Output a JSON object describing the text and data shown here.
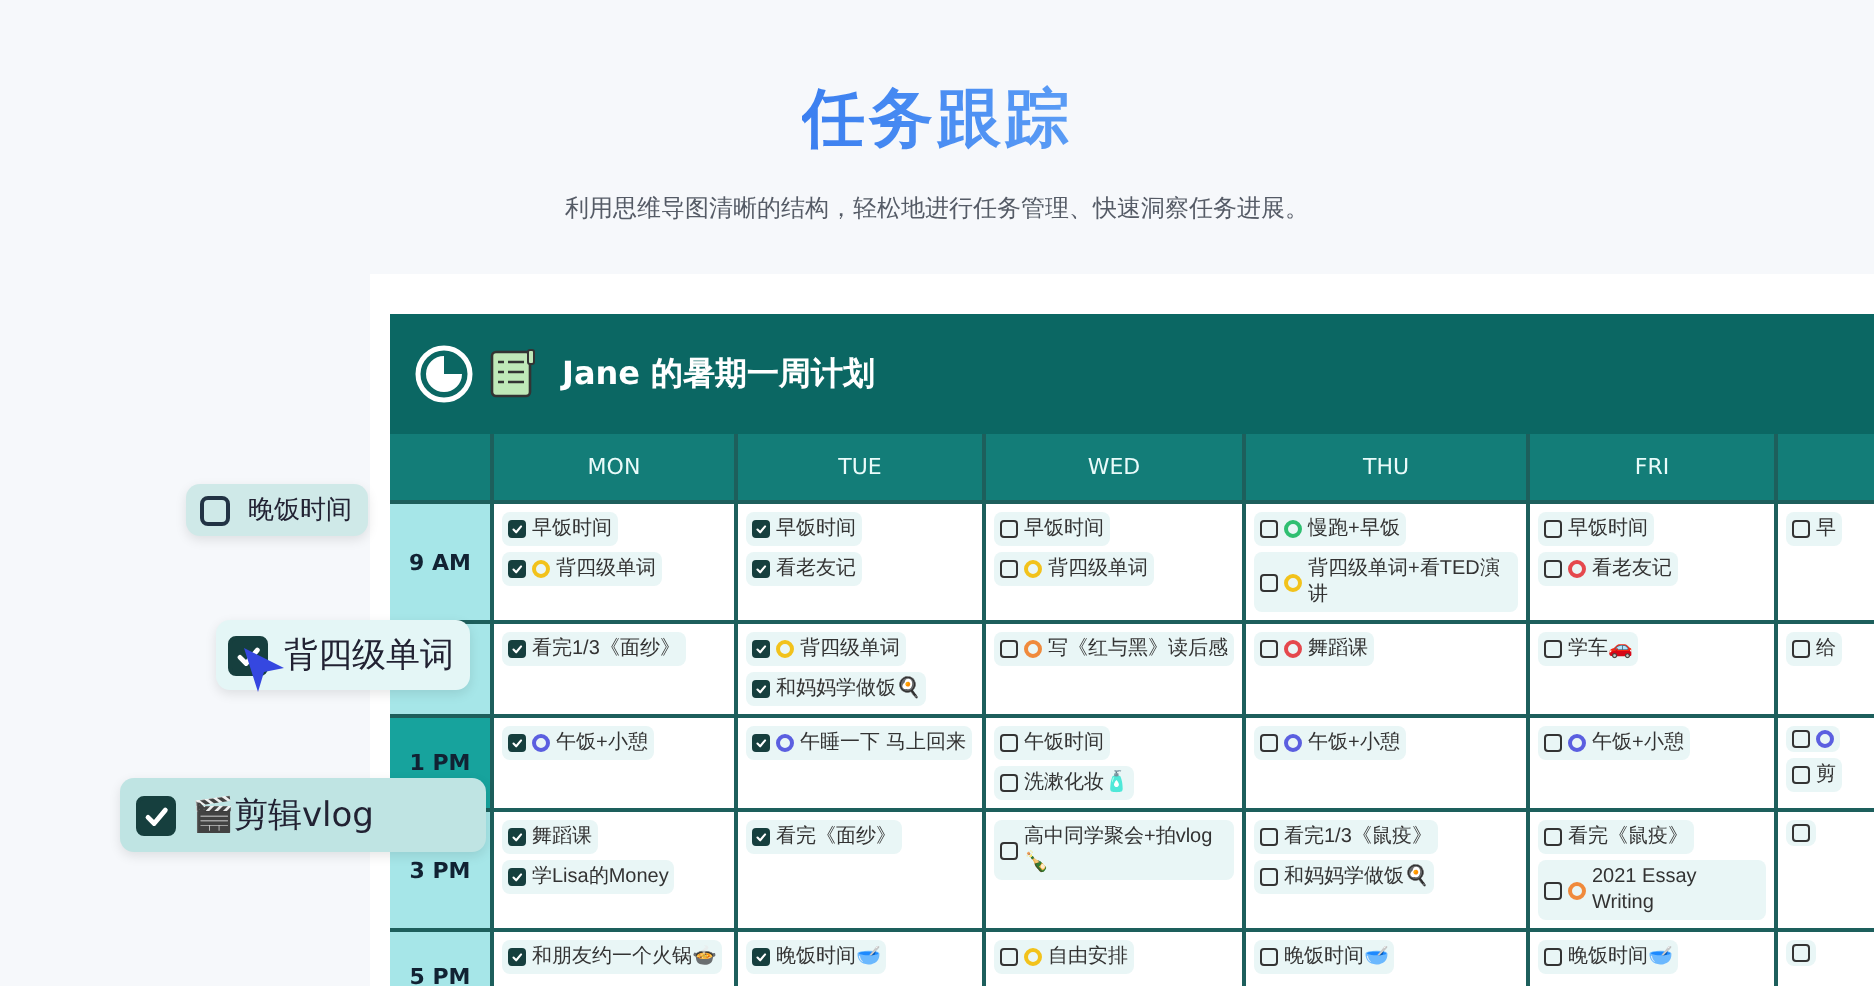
{
  "heading": {
    "title": "任务跟踪",
    "subtitle": "利用思维导图清晰的结构，轻松地进行任务管理、快速洞察任务进展。"
  },
  "planner": {
    "title": "Jane 的暑期一周计划",
    "days": [
      {
        "label": "MON"
      },
      {
        "label": "TUE"
      },
      {
        "label": "WED"
      },
      {
        "label": "THU"
      },
      {
        "label": "FRI"
      }
    ],
    "rows": [
      {
        "time": "9 AM",
        "highlighted": false,
        "cells": [
          [
            {
              "text": "早饭时间",
              "checked": true
            },
            {
              "text": "背四级单词",
              "checked": true,
              "color": "#f2c21b"
            }
          ],
          [
            {
              "text": "早饭时间",
              "checked": true
            },
            {
              "text": "看老友记",
              "checked": true
            }
          ],
          [
            {
              "text": "早饭时间",
              "checked": false
            },
            {
              "text": "背四级单词",
              "checked": false,
              "color": "#f2c21b"
            }
          ],
          [
            {
              "text": "慢跑+早饭",
              "checked": false,
              "color": "#2fbf71"
            },
            {
              "text": "背四级单词+看TED演讲",
              "checked": false,
              "color": "#f2c21b"
            }
          ],
          [
            {
              "text": "早饭时间",
              "checked": false
            },
            {
              "text": "看老友记",
              "checked": false,
              "color": "#e5484d"
            }
          ],
          [
            {
              "text": "早",
              "checked": false
            }
          ]
        ]
      },
      {
        "highlighted": false,
        "cells": [
          [
            {
              "text": "看完1/3《面纱》",
              "checked": true
            }
          ],
          [
            {
              "text": "背四级单词",
              "checked": true,
              "color": "#f2c21b"
            },
            {
              "text": "和妈妈学做饭🍳",
              "checked": true
            }
          ],
          [
            {
              "text": "写《红与黑》读后感",
              "checked": false,
              "color": "#f08a3c"
            }
          ],
          [
            {
              "text": "舞蹈课",
              "checked": false,
              "color": "#e5484d"
            }
          ],
          [
            {
              "text": "学车🚗",
              "checked": false
            }
          ],
          [
            {
              "text": "给",
              "checked": false
            }
          ]
        ]
      },
      {
        "time": "1 PM",
        "highlighted": true,
        "cells": [
          [
            {
              "text": "午饭+小憩",
              "checked": true,
              "color": "#5b5fe0"
            }
          ],
          [
            {
              "text": "午睡一下 马上回来",
              "checked": true,
              "color": "#5b5fe0"
            }
          ],
          [
            {
              "text": "午饭时间",
              "checked": false
            },
            {
              "text": "洗漱化妆🧴",
              "checked": false
            }
          ],
          [
            {
              "text": "午饭+小憩",
              "checked": false,
              "color": "#5b5fe0"
            }
          ],
          [
            {
              "text": "午饭+小憩",
              "checked": false,
              "color": "#5b5fe0"
            }
          ],
          [
            {
              "checked": false,
              "color": "#5b5fe0"
            },
            {
              "text": "剪",
              "checked": false
            }
          ]
        ]
      },
      {
        "time": "3 PM",
        "highlighted": false,
        "cells": [
          [
            {
              "text": "舞蹈课",
              "checked": true
            },
            {
              "text": "学Lisa的Money",
              "checked": true
            }
          ],
          [
            {
              "text": "看完《面纱》",
              "checked": true
            }
          ],
          [
            {
              "text": "高中同学聚会+拍vlog🍾",
              "checked": false
            }
          ],
          [
            {
              "text": "看完1/3《鼠疫》",
              "checked": false
            },
            {
              "text": "和妈妈学做饭🍳",
              "checked": false
            }
          ],
          [
            {
              "text": "看完《鼠疫》",
              "checked": false
            },
            {
              "text": "2021 Essay Writing",
              "checked": false,
              "color": "#f08a3c"
            }
          ],
          [
            {
              "checked": false
            }
          ]
        ]
      },
      {
        "time": "5 PM",
        "highlighted": false,
        "cells": [
          [
            {
              "text": "和朋友约一个火锅🍲",
              "checked": true
            }
          ],
          [
            {
              "text": "晚饭时间🥣",
              "checked": true
            }
          ],
          [
            {
              "text": "自由安排",
              "checked": false,
              "color": "#f2c21b"
            }
          ],
          [
            {
              "text": "晚饭时间🥣",
              "checked": false
            }
          ],
          [
            {
              "text": "晚饭时间🥣",
              "checked": false
            }
          ],
          [
            {
              "checked": false
            }
          ]
        ]
      }
    ]
  },
  "floating_tasks": [
    {
      "text": "晚饭时间",
      "checked": false
    },
    {
      "text": "背四级单词",
      "checked": true
    },
    {
      "text": "🎬剪辑vlog",
      "checked": true
    }
  ]
}
